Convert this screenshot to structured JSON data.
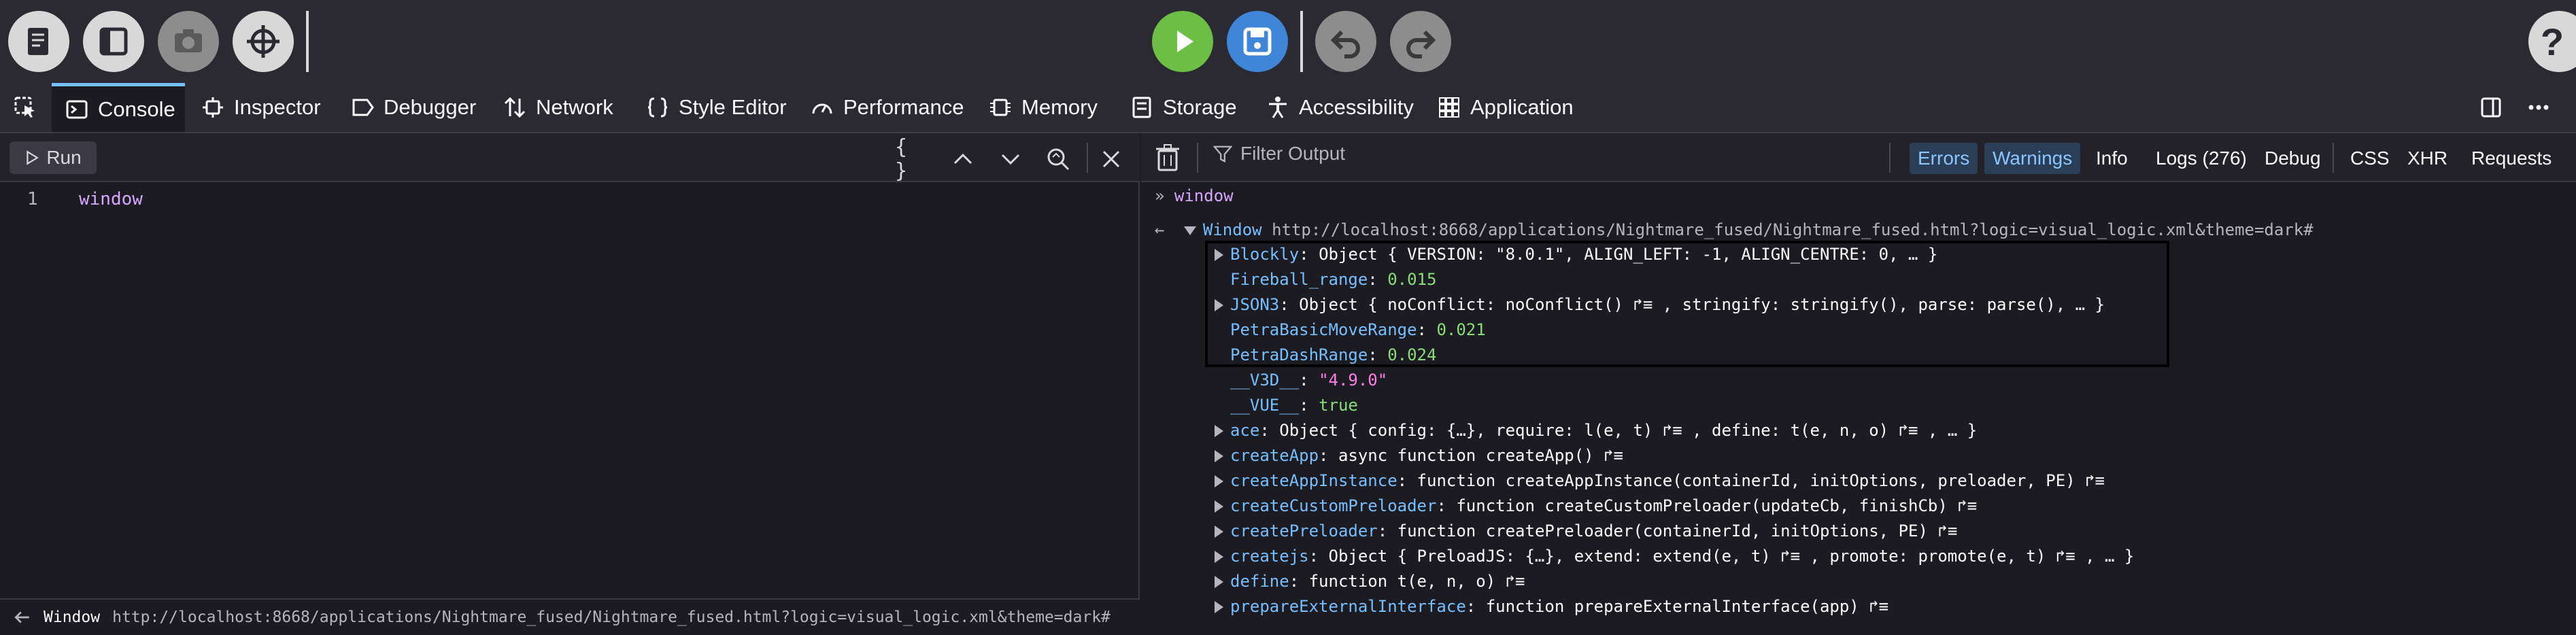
{
  "toolbar": {
    "buttons": [
      "book-icon",
      "panel-icon",
      "camera-icon",
      "crosshair-icon",
      "play-icon",
      "save-icon",
      "undo-icon",
      "redo-icon",
      "help-icon"
    ],
    "colors": {
      "play": "#6dbe45",
      "save": "#3f86d8",
      "muted": "#8d8d8d",
      "light": "#d8d8d8"
    }
  },
  "tabs": [
    {
      "label": "Console",
      "icon": "console-icon"
    },
    {
      "label": "Inspector",
      "icon": "inspector-icon"
    },
    {
      "label": "Debugger",
      "icon": "debugger-icon"
    },
    {
      "label": "Network",
      "icon": "network-icon"
    },
    {
      "label": "Style Editor",
      "icon": "style-editor-icon"
    },
    {
      "label": "Performance",
      "icon": "performance-icon"
    },
    {
      "label": "Memory",
      "icon": "memory-icon"
    },
    {
      "label": "Storage",
      "icon": "storage-icon"
    },
    {
      "label": "Accessibility",
      "icon": "accessibility-icon"
    },
    {
      "label": "Application",
      "icon": "application-icon"
    }
  ],
  "editor": {
    "run_label": "Run",
    "pretty_label": "{ }",
    "line_number": "1",
    "code": "window",
    "status_label": "Window",
    "status_url": "http://localhost:8668/applications/Nightmare_fused/Nightmare_fused.html?logic=visual_logic.xml&theme=dark#"
  },
  "output": {
    "filter_placeholder": "Filter Output",
    "filters": [
      "Errors",
      "Warnings",
      "Info",
      "Logs (276)",
      "Debug",
      "CSS",
      "XHR",
      "Requests"
    ],
    "input_echo": "window",
    "window_label": "Window",
    "window_url": "http://localhost:8668/applications/Nightmare_fused/Nightmare_fused.html?logic=visual_logic.xml&theme=dark#",
    "props": [
      {
        "name": "Blockly",
        "value": "Object { VERSION: \"8.0.1\", ALIGN_LEFT: -1, ALIGN_CENTRE: 0, … }",
        "expandable": true
      },
      {
        "name": "Fireball_range",
        "value": "0.015",
        "expandable": false
      },
      {
        "name": "JSON3",
        "value": "Object { noConflict: noConflict() ↱≡ , stringify: stringify(), parse: parse(), … }",
        "expandable": true
      },
      {
        "name": "PetraBasicMoveRange",
        "value": "0.021",
        "expandable": false
      },
      {
        "name": "PetraDashRange",
        "value": "0.024",
        "expandable": false
      },
      {
        "name": "__V3D__",
        "value": "\"4.9.0\"",
        "expandable": false
      },
      {
        "name": "__VUE__",
        "value": "true",
        "expandable": false
      },
      {
        "name": "ace",
        "value": "Object { config: {…}, require: l(e, t) ↱≡ , define: t(e, n, o) ↱≡ , … }",
        "expandable": true
      },
      {
        "name": "createApp",
        "value": "async function createApp() ↱≡",
        "expandable": true
      },
      {
        "name": "createAppInstance",
        "value": "function createAppInstance(containerId, initOptions, preloader, PE) ↱≡",
        "expandable": true
      },
      {
        "name": "createCustomPreloader",
        "value": "function createCustomPreloader(updateCb, finishCb) ↱≡",
        "expandable": true
      },
      {
        "name": "createPreloader",
        "value": "function createPreloader(containerId, initOptions, PE) ↱≡",
        "expandable": true
      },
      {
        "name": "createjs",
        "value": "Object { PreloadJS: {…}, extend: extend(e, t) ↱≡ , promote: promote(e, t) ↱≡ , … }",
        "expandable": true
      },
      {
        "name": "define",
        "value": "function t(e, n, o) ↱≡",
        "expandable": true
      },
      {
        "name": "prepareExternalInterface",
        "value": "function prepareExternalInterface(app) ↱≡",
        "expandable": true
      }
    ]
  }
}
